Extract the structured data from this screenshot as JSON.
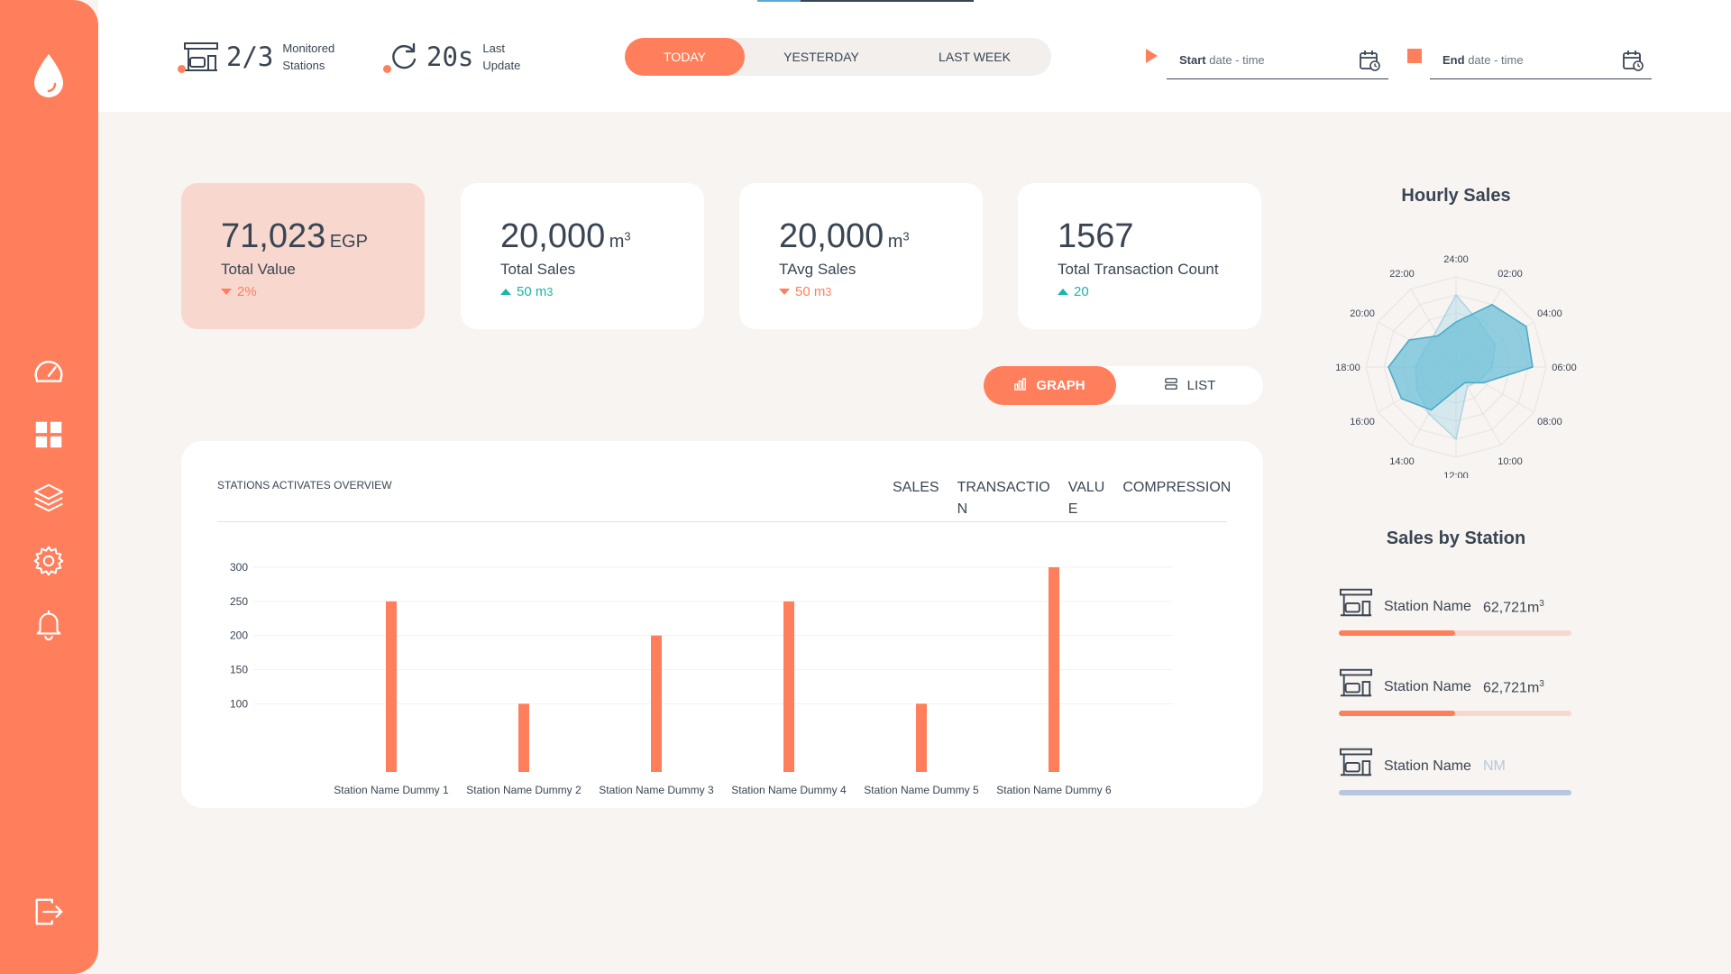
{
  "colors": {
    "accent": "#ff7f5c",
    "text": "#3a4553",
    "teal": "#1ab5a8",
    "radar": "#6cc0d8",
    "bg": "#f8f4f1"
  },
  "sidebar": {
    "logo": "drop-icon",
    "items": [
      {
        "icon": "speedometer-icon"
      },
      {
        "icon": "dashboard-grid-icon"
      },
      {
        "icon": "layers-icon"
      },
      {
        "icon": "gear-icon"
      },
      {
        "icon": "bell-icon"
      }
    ],
    "logout": "logout-icon"
  },
  "header": {
    "stations": {
      "value": "2/3",
      "label_line1": "Monitored",
      "label_line2": "Stations"
    },
    "update": {
      "value": "20s",
      "label_line1": "Last",
      "label_line2": "Update"
    },
    "ranges": [
      "TODAY",
      "YESTERDAY",
      "LAST WEEK"
    ],
    "active_range": "TODAY",
    "start": {
      "bold": "Start",
      "rest": "date - time"
    },
    "end": {
      "bold": "End",
      "rest": "date - time"
    }
  },
  "kpis": [
    {
      "value": "71,023",
      "unit": "EGP",
      "sup": "",
      "label": "Total Value",
      "delta": "2%",
      "delta_sup": "",
      "direction": "down"
    },
    {
      "value": "20,000",
      "unit": "m",
      "sup": "3",
      "label": "Total Sales",
      "delta": "50 m",
      "delta_sup": "3",
      "direction": "up"
    },
    {
      "value": "20,000",
      "unit": "m",
      "sup": "3",
      "label": "TAvg Sales",
      "delta": "50 m",
      "delta_sup": "3",
      "direction": "down"
    },
    {
      "value": "1567",
      "unit": "",
      "sup": "",
      "label": "Total Transaction Count",
      "delta": "20",
      "delta_sup": "",
      "direction": "up"
    }
  ],
  "view_toggle": {
    "graph": "GRAPH",
    "list": "LIST",
    "active": "GRAPH"
  },
  "overview": {
    "title": "STATIONS ACTIVATES OVERVIEW",
    "tabs": [
      {
        "line1": "SALES",
        "line2": ""
      },
      {
        "line1": "TRANSACTIO",
        "line2": "N"
      },
      {
        "line1": "VALU",
        "line2": "E"
      },
      {
        "line1": "COMPRESSION",
        "line2": ""
      }
    ]
  },
  "chart_data": [
    {
      "type": "bar",
      "title": "",
      "categories": [
        "Station Name Dummy 1",
        "Station Name Dummy 2",
        "Station Name Dummy 3",
        "Station Name Dummy 4",
        "Station Name Dummy 5",
        "Station Name Dummy 6"
      ],
      "values": [
        250,
        100,
        200,
        250,
        100,
        300
      ],
      "yticks": [
        100,
        150,
        200,
        250,
        300
      ],
      "ylim": [
        0,
        300
      ],
      "grid": true
    },
    {
      "type": "radar",
      "title": "Hourly Sales",
      "categories": [
        "24:00",
        "02:00",
        "04:00",
        "06:00",
        "08:00",
        "10:00",
        "12:00",
        "14:00",
        "16:00",
        "18:00",
        "20:00",
        "22:00"
      ],
      "series": [
        {
          "values": [
            0.5,
            0.8,
            0.9,
            0.85,
            0.35,
            0.2,
            0.25,
            0.55,
            0.7,
            0.75,
            0.6,
            0.4
          ]
        },
        {
          "values": [
            0.8,
            0.55,
            0.5,
            0.4,
            0.3,
            0.25,
            0.8,
            0.6,
            0.5,
            0.45,
            0.4,
            0.45
          ]
        }
      ],
      "rmax": 1
    }
  ],
  "sales_by_station": {
    "title": "Sales by Station",
    "items": [
      {
        "name": "Station Name",
        "value": "62,721m",
        "sup": "3",
        "fraction": 0.5,
        "na": false
      },
      {
        "name": "Station Name",
        "value": "62,721m",
        "sup": "3",
        "fraction": 0.5,
        "na": false
      },
      {
        "name": "Station Name",
        "value": "NM",
        "sup": "",
        "fraction": 0,
        "na": true
      }
    ]
  }
}
